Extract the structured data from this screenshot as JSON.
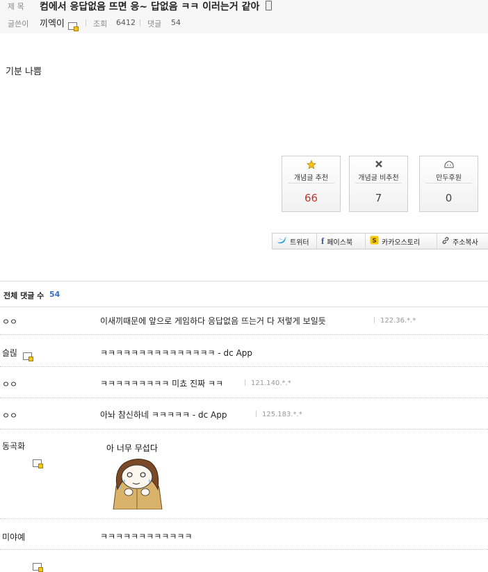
{
  "post": {
    "title_label": "제 목",
    "title": "컴에서 응답없음 뜨면 응~ 답없음 ㅋㅋ 이러는거 같아",
    "author_label": "글쓴이",
    "author": "끼엑이",
    "views_label": "조회",
    "views": "6412",
    "comments_label": "댓글",
    "comments": "54",
    "body": "기분 나쁨"
  },
  "votes": [
    {
      "label": "개념글 추천",
      "count": "66",
      "icon": "star-icon",
      "color": "#c0392b"
    },
    {
      "label": "개념글 비추천",
      "count": "7",
      "icon": "x-icon",
      "color": "#444444"
    },
    {
      "label": "만두후원",
      "count": "0",
      "icon": "mandu-icon",
      "color": "#444444"
    }
  ],
  "share": [
    {
      "label": "트위터",
      "icon": "twitter-icon"
    },
    {
      "label": "페이스북",
      "icon": "facebook-icon"
    },
    {
      "label": "카카오스토리",
      "icon": "kakaostory-icon"
    },
    {
      "label": "주소복사",
      "icon": "link-icon"
    }
  ],
  "comments_section": {
    "header": "전체 댓글 수",
    "count": "54",
    "items": [
      {
        "nick": "ㅇㅇ",
        "text": "이새끼때문에 앞으로 게임하다 응답없음 뜨는거 다 저렇게 보일듯",
        "ip": "122.36.*.*"
      },
      {
        "nick": "슬릲",
        "text": "ㅋㅋㅋㅋㅋㅋㅋㅋㅋㅋㅋㅋㅋㅋㅋ - dc App",
        "ip": ""
      },
      {
        "nick": "ㅇㅇ",
        "text": "ㅋㅋㅋㅋㅋㅋㅋㅋㅋ 미쵸 진짜 ㅋㅋ",
        "ip": "121.140.*.*"
      },
      {
        "nick": "ㅇㅇ",
        "text": "아놔 참신하네 ㅋㅋㅋㅋㅋ - dc App",
        "ip": "125.183.*.*"
      },
      {
        "nick": "동곡화",
        "text": "",
        "ip": "",
        "image_caption": "아 너무 무섭다"
      },
      {
        "nick": "미야예",
        "text": "ㅋㅋㅋㅋㅋㅋㅋㅋㅋㅋㅋㅋ",
        "ip": ""
      }
    ]
  }
}
